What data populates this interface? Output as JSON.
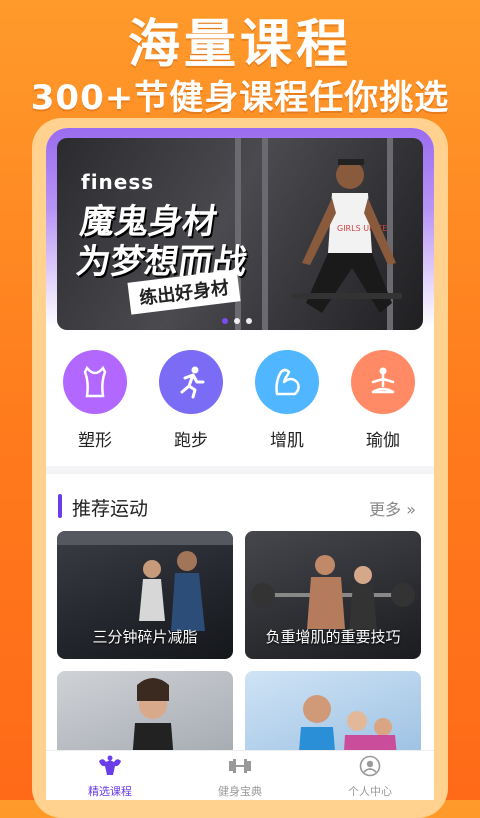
{
  "promo": {
    "title": "海量课程",
    "subtitle": "300+节健身课程任你挑选"
  },
  "banner": {
    "eng": "finess",
    "line1": "魔鬼身材",
    "line2": "为梦想而战",
    "tag": "练出好身材",
    "shirt_text": "GIRLS UNITE",
    "dots": 3,
    "active_dot": 0
  },
  "categories": [
    {
      "label": "塑形",
      "icon": "body-shape-icon",
      "color": "#b267ff"
    },
    {
      "label": "跑步",
      "icon": "running-icon",
      "color": "#7a6cf5"
    },
    {
      "label": "增肌",
      "icon": "muscle-arm-icon",
      "color": "#4fb6ff"
    },
    {
      "label": "瑜伽",
      "icon": "yoga-icon",
      "color": "#ff8a65"
    }
  ],
  "section": {
    "title": "推荐运动",
    "more": "更多 »"
  },
  "cards": [
    {
      "caption": "三分钟碎片减脂"
    },
    {
      "caption": "负重增肌的重要技巧"
    },
    {
      "caption": ""
    },
    {
      "caption": ""
    }
  ],
  "tabs": [
    {
      "label": "精选课程",
      "icon": "bodybuilder-icon",
      "active": true
    },
    {
      "label": "健身宝典",
      "icon": "dumbbell-icon",
      "active": false
    },
    {
      "label": "个人中心",
      "icon": "user-icon",
      "active": false
    }
  ],
  "colors": {
    "accent": "#6a3de8",
    "background": "#ff8a24"
  }
}
